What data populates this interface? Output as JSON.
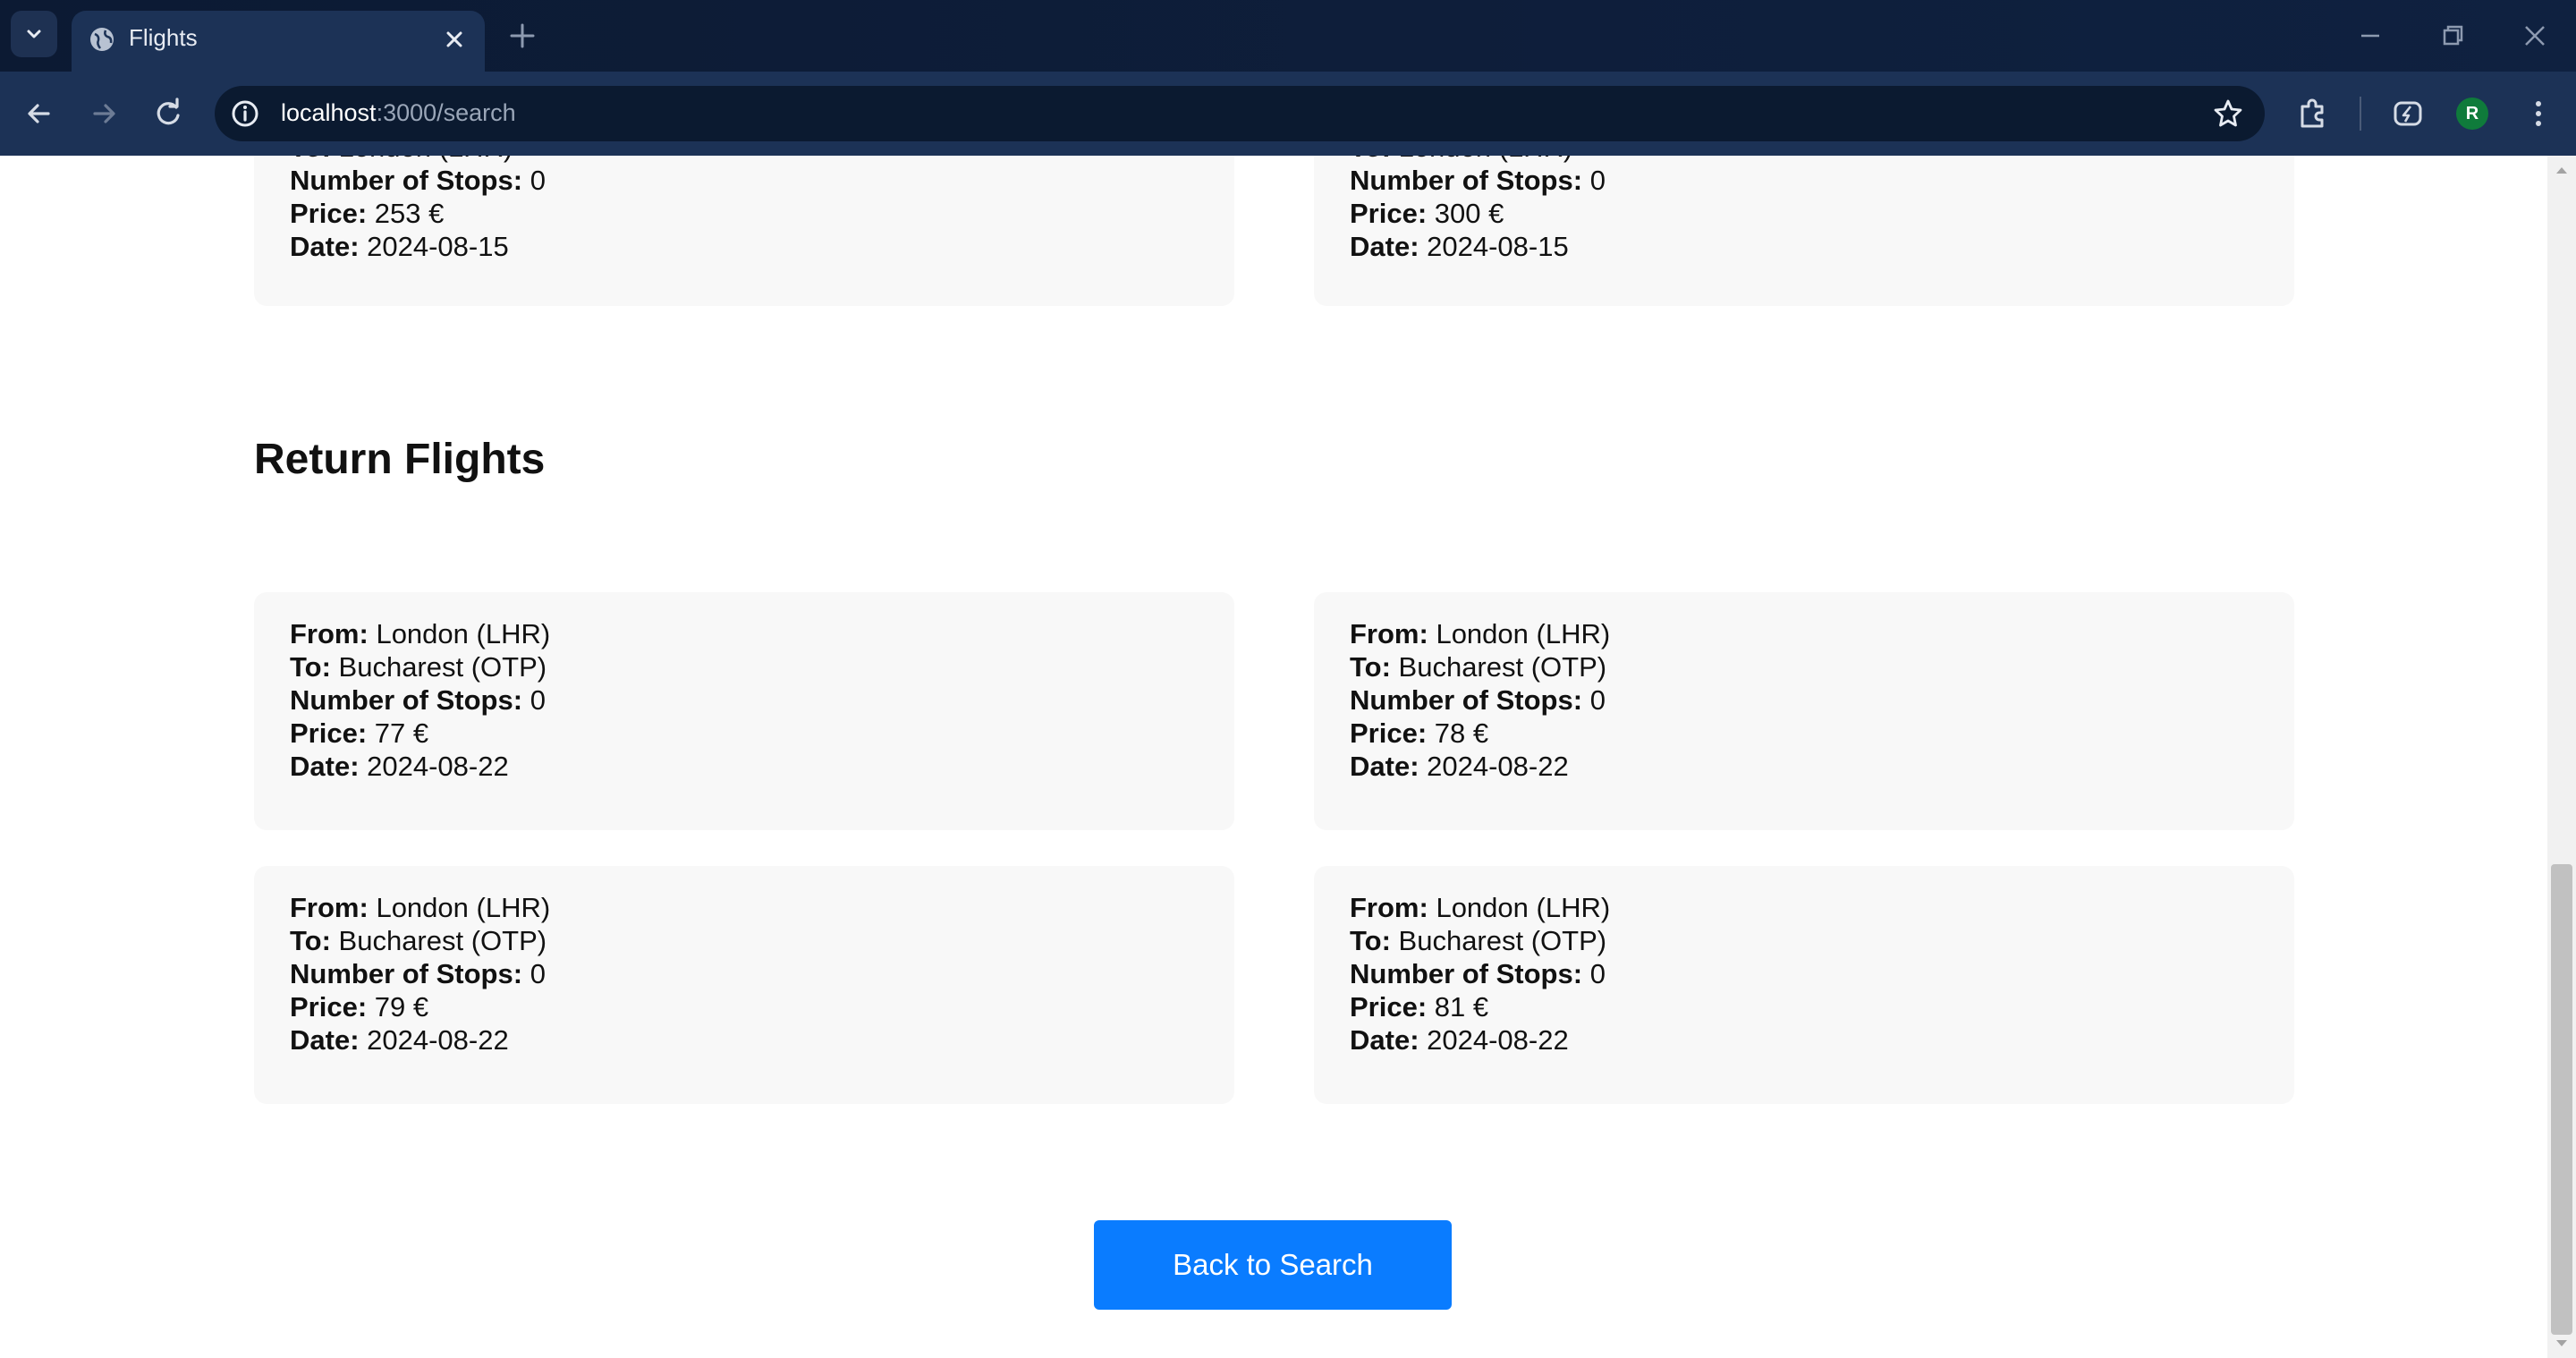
{
  "browser": {
    "tab_title": "Flights",
    "url_host": "localhost",
    "url_path": ":3000/search",
    "avatar_letter": "R"
  },
  "outbound_partial": [
    {
      "to_label": "To:",
      "to_value": "London (LHR)",
      "stops_label": "Number of Stops:",
      "stops_value": "0",
      "price_label": "Price:",
      "price_value": "253 €",
      "date_label": "Date:",
      "date_value": "2024-08-15"
    },
    {
      "to_label": "To:",
      "to_value": "London (LHR)",
      "stops_label": "Number of Stops:",
      "stops_value": "0",
      "price_label": "Price:",
      "price_value": "300 €",
      "date_label": "Date:",
      "date_value": "2024-08-15"
    }
  ],
  "return_section": {
    "title": "Return Flights",
    "flights": [
      {
        "from_label": "From:",
        "from_value": "London (LHR)",
        "to_label": "To:",
        "to_value": "Bucharest (OTP)",
        "stops_label": "Number of Stops:",
        "stops_value": "0",
        "price_label": "Price:",
        "price_value": "77 €",
        "date_label": "Date:",
        "date_value": "2024-08-22"
      },
      {
        "from_label": "From:",
        "from_value": "London (LHR)",
        "to_label": "To:",
        "to_value": "Bucharest (OTP)",
        "stops_label": "Number of Stops:",
        "stops_value": "0",
        "price_label": "Price:",
        "price_value": "78 €",
        "date_label": "Date:",
        "date_value": "2024-08-22"
      },
      {
        "from_label": "From:",
        "from_value": "London (LHR)",
        "to_label": "To:",
        "to_value": "Bucharest (OTP)",
        "stops_label": "Number of Stops:",
        "stops_value": "0",
        "price_label": "Price:",
        "price_value": "79 €",
        "date_label": "Date:",
        "date_value": "2024-08-22"
      },
      {
        "from_label": "From:",
        "from_value": "London (LHR)",
        "to_label": "To:",
        "to_value": "Bucharest (OTP)",
        "stops_label": "Number of Stops:",
        "stops_value": "0",
        "price_label": "Price:",
        "price_value": "81 €",
        "date_label": "Date:",
        "date_value": "2024-08-22"
      }
    ]
  },
  "back_button_label": "Back to Search",
  "colors": {
    "accent": "#0a7cff",
    "card_bg": "#f8f8f8",
    "chrome_bg": "#0f2140"
  }
}
